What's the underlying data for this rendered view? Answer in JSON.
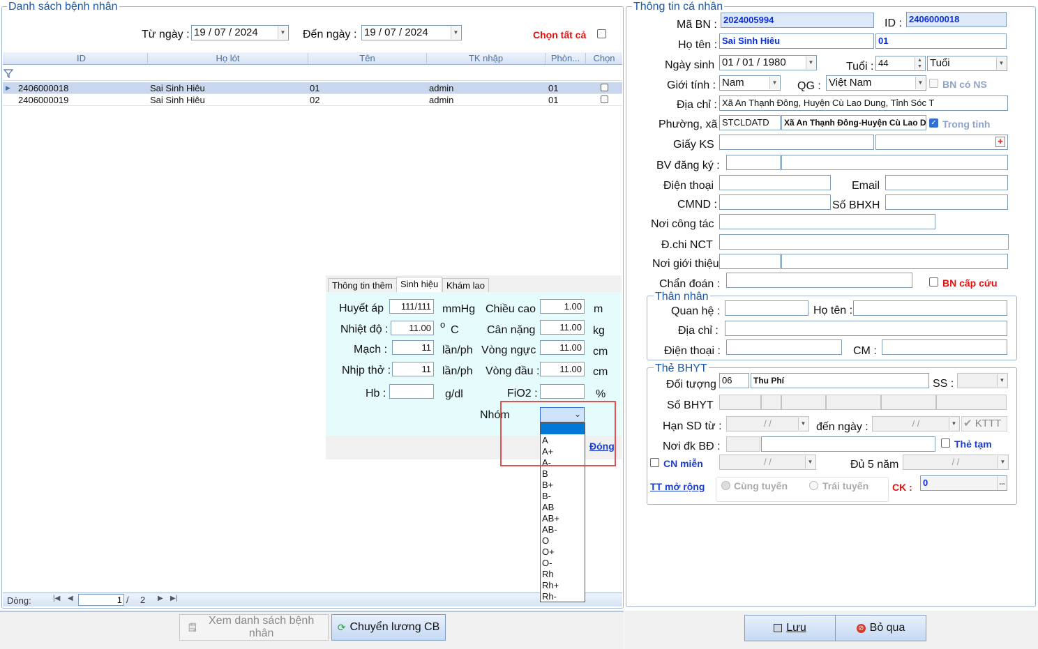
{
  "left_panel": {
    "title": "Danh sách bệnh nhân",
    "from_label": "Từ ngày :",
    "from_date": "19 / 07 / 2024",
    "to_label": "Đến  ngày :",
    "to_date": "19 / 07 / 2024",
    "select_all": "Chọn tất cả",
    "columns": [
      "ID",
      "Họ lót",
      "Tên",
      "TK nhập",
      "Phòn...",
      "Chọn"
    ],
    "rows": [
      {
        "id": "2406000018",
        "holot": "Sai Sinh Hiêu",
        "ten": "01",
        "tk": "admin",
        "phong": "01"
      },
      {
        "id": "2406000019",
        "holot": "Sai Sinh Hiêu",
        "ten": "02",
        "tk": "admin",
        "phong": "01"
      }
    ],
    "pager": {
      "label": "Dòng:",
      "current": "1",
      "sep": "/",
      "total": "2"
    }
  },
  "vitals": {
    "tabs": [
      "Thông tin thêm",
      "Sinh hiệu",
      "Khám lao"
    ],
    "huyet_ap": {
      "label": "Huyết áp",
      "value": "111/111",
      "unit": "mmHg"
    },
    "nhiet_do": {
      "label": "Nhiệt độ :",
      "value": "11.00",
      "unit_o": "o",
      "unit": "C"
    },
    "mach": {
      "label": "Mạch :",
      "value": "11",
      "unit": "lần/ph"
    },
    "nhip_tho": {
      "label": "Nhịp thở :",
      "value": "11",
      "unit": "lần/ph"
    },
    "hb": {
      "label": "Hb :",
      "value": "",
      "unit": "g/dl"
    },
    "chieu_cao": {
      "label": "Chiều cao",
      "value": "1.00",
      "unit": "m"
    },
    "can_nang": {
      "label": "Cân nặng",
      "value": "11.00",
      "unit": "kg"
    },
    "vong_nguc": {
      "label": "Vòng ngực",
      "value": "11.00",
      "unit": "cm"
    },
    "vong_dau": {
      "label": "Vòng đầu :",
      "value": "11.00",
      "unit": "cm"
    },
    "fio2": {
      "label": "FiO2 :",
      "value": "",
      "unit": "%"
    },
    "nhom_label": "Nhóm",
    "close_link": "Đóng",
    "blood_options": [
      "A",
      "A+",
      "A-",
      "B",
      "B+",
      "B-",
      "AB",
      "AB+",
      "AB-",
      "O",
      "O+",
      "O-",
      "Rh",
      "Rh+",
      "Rh-"
    ]
  },
  "right_panel": {
    "title": "Thông tin cá nhân",
    "ma_bn_label": "Mã BN :",
    "ma_bn": "2024005994",
    "id_label": "ID :",
    "id": "2406000018",
    "ho_ten_label": "Họ tên :",
    "ho_ten": "Sai Sinh Hiêu",
    "ho_ten2": "01",
    "ngay_sinh_label": "Ngày sinh",
    "ngay_sinh": "01 / 01 / 1980",
    "tuoi_label": "Tuổi :",
    "tuoi": "44",
    "tuoi_unit": "Tuổi",
    "gioi_tinh_label": "Giới tính :",
    "gioi_tinh": "Nam",
    "qg_label": "QG :",
    "qg": "Việt Nam",
    "bn_co_ns": "BN có NS",
    "dia_chi_label": "Địa chỉ :",
    "dia_chi": "Xã An Thạnh Đông, Huyện Cù Lao Dung, Tỉnh Sóc T",
    "phuong_xa_label": "Phường, xã",
    "phuong_xa_code": "STCLDATD",
    "phuong_xa": "Xã An Thạnh Đông-Huyện Cù Lao D",
    "trong_tinh": "Trong tỉnh",
    "giay_ks_label": "Giấy KS",
    "bv_dang_ky_label": "BV đăng ký :",
    "dien_thoai_label": "Điện thoại",
    "email_label": "Email",
    "cmnd_label": "CMND :",
    "so_bhxh_label": "Số BHXH",
    "noi_cong_tac_label": "Nơi công tác",
    "dchi_nct_label": "Đ.chi NCT",
    "noi_gioi_thieu_label": "Nơi giới thiệu",
    "chan_doan_label": "Chẩn đoán :",
    "bn_cap_cuu": "BN cấp cứu",
    "than_nhan": {
      "title": "Thân nhân",
      "quan_he": "Quan hệ :",
      "ho_ten": "Họ tên :",
      "dia_chi": "Địa chỉ :",
      "dien_thoai": "Điện thoại :",
      "cm": "CM :"
    },
    "bhyt": {
      "title": "Thẻ BHYT",
      "doi_tuong_label": "Đối tượng",
      "doi_tuong_code": "06",
      "doi_tuong": "Thu Phí",
      "ss_label": "SS :",
      "so_bhyt_label": "Số BHYT",
      "han_sd_label": "Hạn SD từ :",
      "den_ngay_label": "đến  ngày :",
      "date_blank": " /    / ",
      "kttt": "KTTT",
      "noi_dk_label": "Nơi đk BĐ :",
      "the_tam": "Thẻ tạm",
      "cn_mien": "CN miễn",
      "du5nam_label": "Đủ 5 năm",
      "tt_mo_rong": "TT mở rộng",
      "cung_tuyen": "Cùng tuyến",
      "trai_tuyen": "Trái tuyến",
      "ck_label": "CK :",
      "ck_value": "0"
    }
  },
  "buttons": {
    "xem_ds": "Xem danh sách bệnh nhân",
    "chuyen_luong": "Chuyển lương CB",
    "luu": "Lưu",
    "bo_qua": "Bỏ qua"
  },
  "colors": {
    "accent": "#1a58a8",
    "highlight_box": "#e05050",
    "vitals_bg": "#e6fbfb",
    "selected": "#0078d7"
  }
}
